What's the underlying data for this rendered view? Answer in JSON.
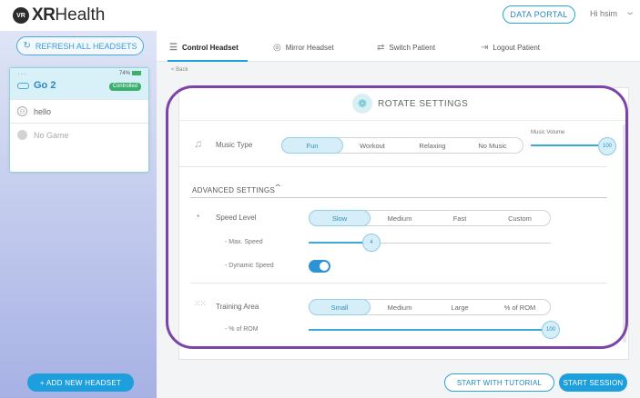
{
  "header": {
    "logo_mark": "VR",
    "logo_xr": "XR",
    "logo_rest": "Health",
    "data_portal_label": "DATA PORTAL",
    "greeting": "Hi hsim"
  },
  "sidebar": {
    "refresh_label": "REFRESH ALL HEADSETS",
    "headset": {
      "battery": "74%",
      "name": "Go 2",
      "status": "Controlled",
      "user": "hello",
      "game": "No Game"
    },
    "add_label": "+ ADD NEW HEADSET"
  },
  "tabs": [
    {
      "label": "Control Headset"
    },
    {
      "label": "Mirror Headset"
    },
    {
      "label": "Switch Patient"
    },
    {
      "label": "Logout Patient"
    }
  ],
  "back_label": "< Back",
  "panel": {
    "title": "ROTATE SETTINGS",
    "music": {
      "label": "Music Type",
      "options": [
        "Fun",
        "Workout",
        "Relaxing",
        "No Music"
      ],
      "selected": "Fun",
      "volume_label": "Music Volume",
      "volume_value": "100",
      "volume_level": 1.0
    },
    "advanced_title": "ADVANCED SETTINGS",
    "speed": {
      "label": "Speed Level",
      "options": [
        "Slow",
        "Medium",
        "Fast",
        "Custom"
      ],
      "selected": "Slow",
      "max_speed_label": "- Max. Speed",
      "max_speed_value": "4",
      "max_speed_level": 0.26,
      "dynamic_label": "- Dynamic Speed",
      "dynamic_on": true
    },
    "training": {
      "label": "Training Area",
      "options": [
        "Small",
        "Medium",
        "Large",
        "% of ROM"
      ],
      "selected": "Small",
      "rom_label": "- % of ROM",
      "rom_value": "100",
      "rom_level": 1.0
    }
  },
  "footer": {
    "tutorial_label": "START WITH TUTORIAL",
    "start_label": "START SESSION"
  },
  "colors": {
    "accent": "#1e9fdd",
    "controlled": "#3bb06e",
    "highlight": "#7a44a8"
  }
}
